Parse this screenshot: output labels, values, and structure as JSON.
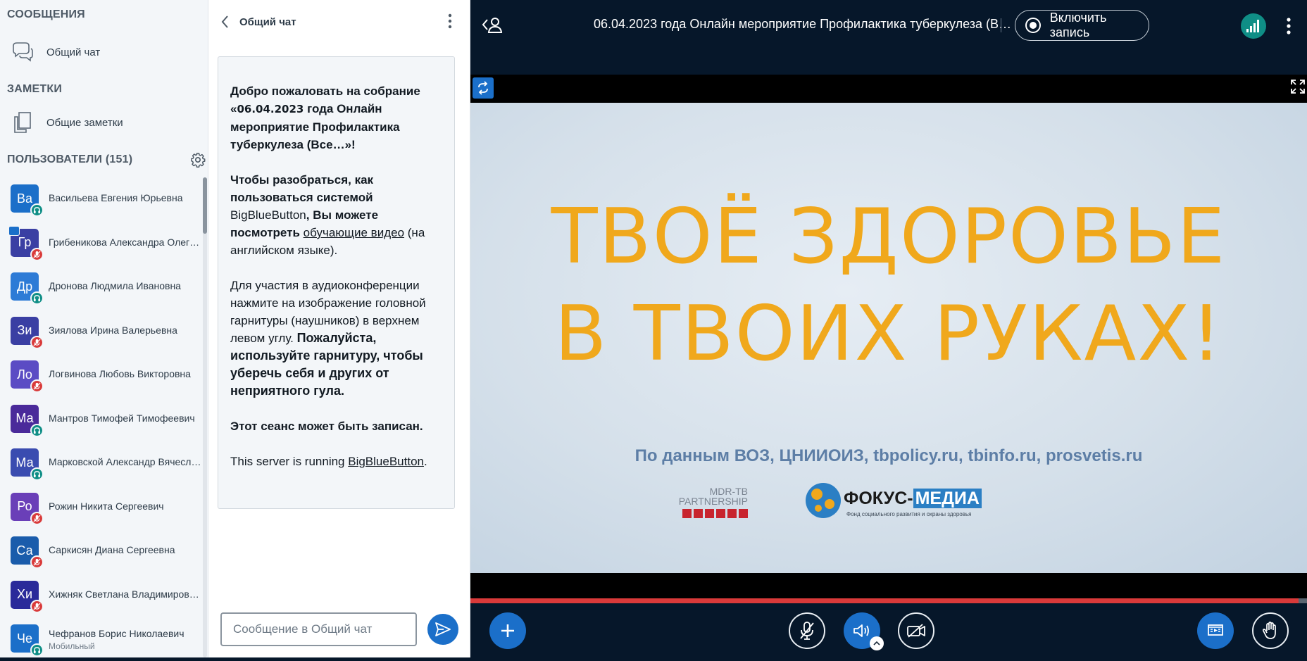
{
  "sidebar": {
    "messages_title": "СООБЩЕНИЯ",
    "public_chat": "Общий чат",
    "notes_title": "ЗАМЕТКИ",
    "shared_notes": "Общие заметки",
    "users_title": "ПОЛЬЗОВАТЕЛИ",
    "users_count": "(151)",
    "users": [
      {
        "initials": "Ва",
        "name": "Васильева Евгения Юрьевна",
        "color": "#1b6fc9",
        "status": "listen"
      },
      {
        "initials": "Гр",
        "name": "Грибеникова Александра Олег…",
        "color": "#3a3fa3",
        "status": "muted",
        "presenter": true
      },
      {
        "initials": "Др",
        "name": "Дронова Людмила Ивановна",
        "color": "#2d7bd6",
        "status": "listen"
      },
      {
        "initials": "Зи",
        "name": "Зиялова Ирина Валерьевна",
        "color": "#3a3fa3",
        "status": "muted"
      },
      {
        "initials": "Ло",
        "name": "Логвинова Любовь Викторовна",
        "color": "#5b4cc4",
        "status": "muted"
      },
      {
        "initials": "Ма",
        "name": "Мантров Тимофей Тимофеевич",
        "color": "#4a2a9a",
        "status": "listen"
      },
      {
        "initials": "Ма",
        "name": "Марковской Александр Вячесл…",
        "color": "#3a4cb0",
        "status": "listen"
      },
      {
        "initials": "Ро",
        "name": "Рожин Никита Сергеевич",
        "color": "#6a3fb8",
        "status": "muted"
      },
      {
        "initials": "Са",
        "name": "Саркисян Диана Сергеевна",
        "color": "#1a5cab",
        "status": "muted"
      },
      {
        "initials": "Хи",
        "name": "Хижняк Светлана Владимиров…",
        "color": "#2a2a9a",
        "status": "muted"
      },
      {
        "initials": "Че",
        "name": "Чефранов Борис Николаевич",
        "sub": "Мобильный",
        "color": "#1b6fc9",
        "status": "listen"
      }
    ]
  },
  "chat": {
    "title": "Общий чат",
    "welcome": {
      "p1_a": "Добро пожаловать на собрание «",
      "p1_date": "06.04.2023",
      "p1_b": " года Онлайн мероприятие Профилактика туберкулеза (Все…»!",
      "p2_a": "Чтобы разобраться, как пользоваться системой ",
      "p2_bbb": "BigBlueButton",
      "p2_b": ", Вы можете посмотреть ",
      "p2_link": "обучающие видео",
      "p2_c": " (на английском языке).",
      "p3_a": "Для участия в аудиоконференции нажмите на изображение головной гарнитуры (наушников) в верхнем левом углу. ",
      "p3_b": "Пожалуйста, используйте гарнитуру, чтобы уберечь себя и других от неприятного гула.",
      "p4": "Этот сеанс может быть записан.",
      "p5_a": "This server is running ",
      "p5_link": "BigBlueButton",
      "p5_b": "."
    },
    "input_placeholder": "Сообщение в Общий чат"
  },
  "main": {
    "meeting_title": "06.04.2023 года Онлайн мероприятие Профилактика туберкулеза (В…",
    "record_label": "Включить запись",
    "video": {
      "headline_line1": "ТВОЁ ЗДОРОВЬЕ",
      "headline_line2": "В ТВОИХ РУКАХ!",
      "source": "По данным ВОЗ, ЦНИИОИЗ, tbpolicy.ru, tbinfo.ru, prosvetis.ru",
      "logo1_line1": "MDR-TB",
      "logo1_line2": "PARTNERSHIP",
      "logo2_a": "ФОКУС-",
      "logo2_b": "МЕДИА",
      "logo2_sub": "Фонд социального развития и охраны здоровья"
    },
    "volume_level": 1.0,
    "playback_progress": 0.99
  },
  "colors": {
    "accent": "#1b6fc9",
    "headline": "#f0a81c",
    "listen_badge": "#0f8e86",
    "muted_badge": "#d93a3a"
  }
}
